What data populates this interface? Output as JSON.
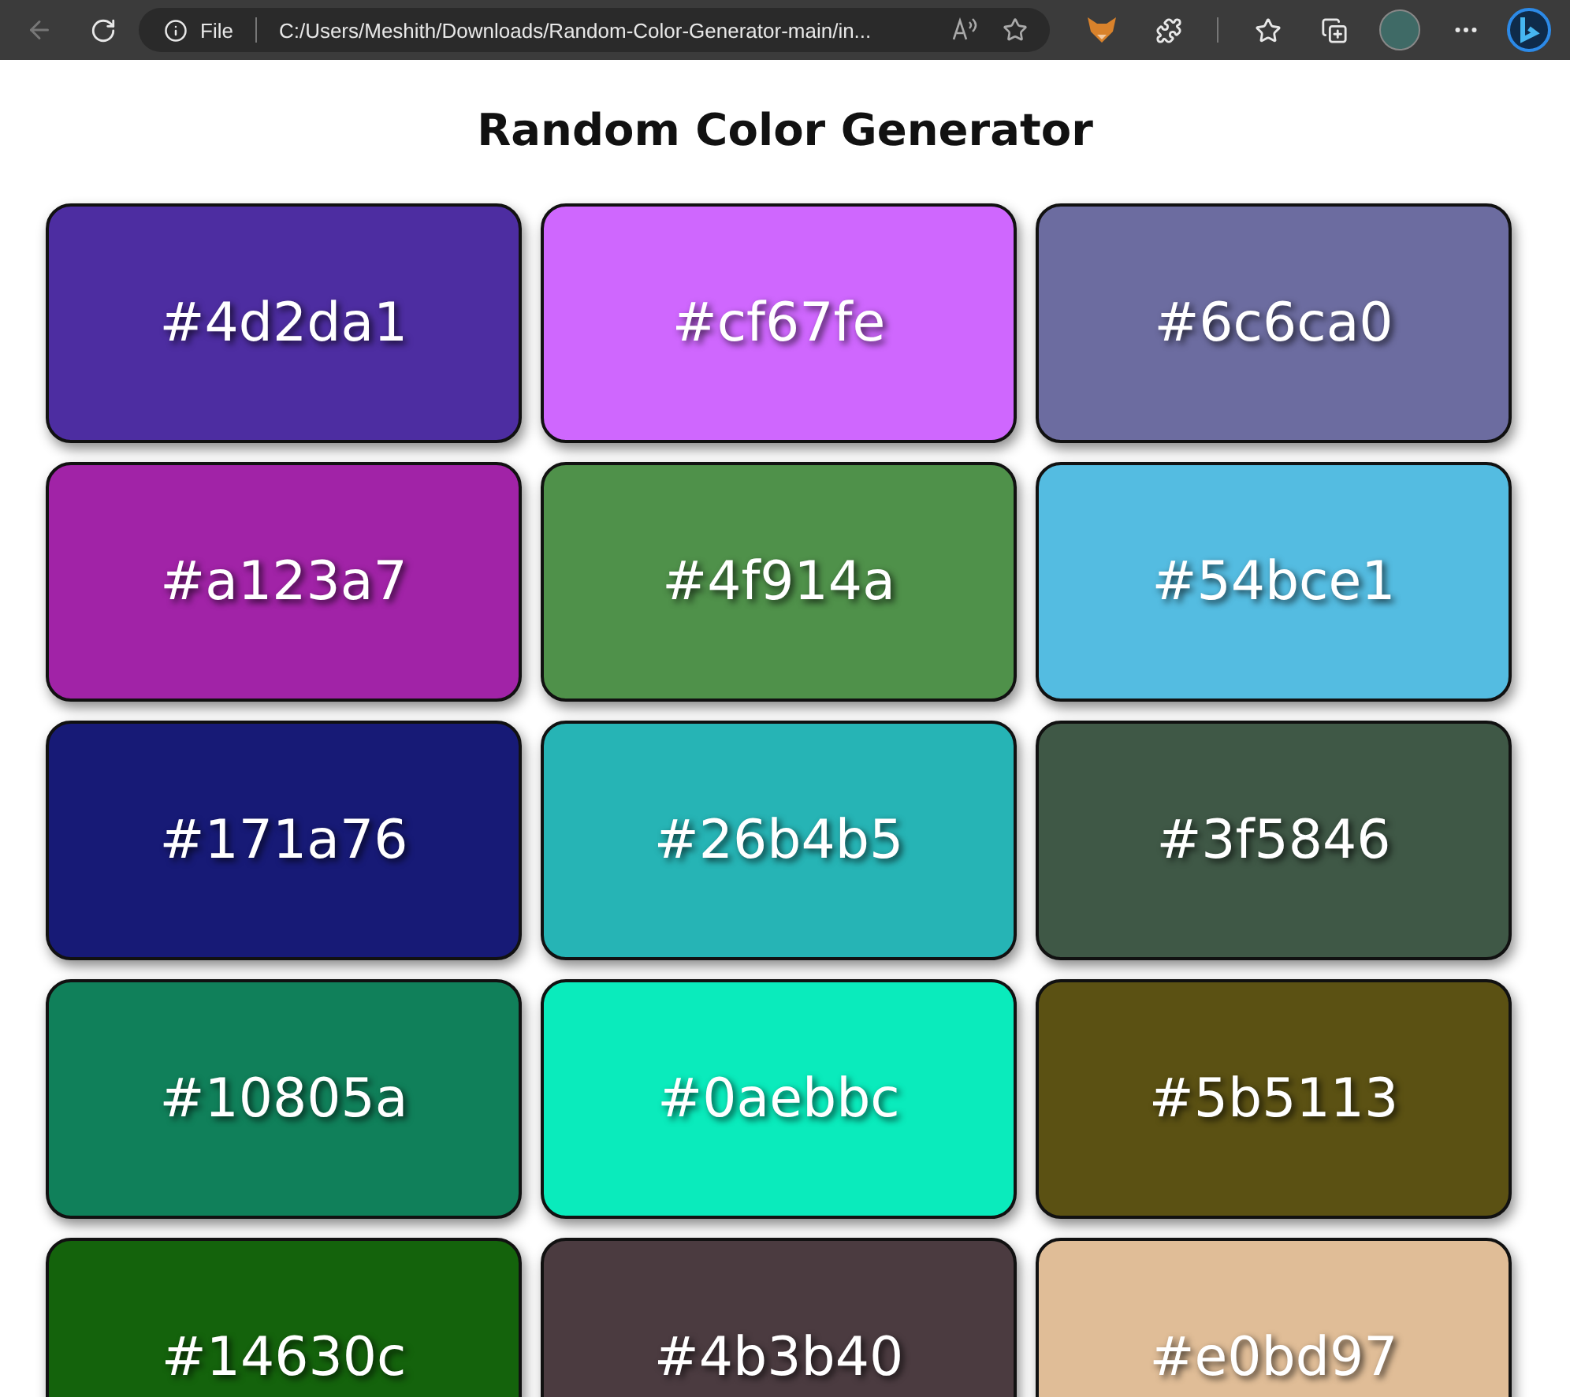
{
  "browser": {
    "back_disabled": true,
    "scheme": "File",
    "url": "C:/Users/Meshith/Downloads/Random-Color-Generator-main/in..."
  },
  "page": {
    "title": "Random Color Generator",
    "cards": [
      {
        "label": "#4d2da1",
        "color": "#4d2da1"
      },
      {
        "label": "#cf67fe",
        "color": "#cf67fe"
      },
      {
        "label": "#6c6ca0",
        "color": "#6c6ca0"
      },
      {
        "label": "#a123a7",
        "color": "#a123a7"
      },
      {
        "label": "#4f914a",
        "color": "#4f914a"
      },
      {
        "label": "#54bce1",
        "color": "#54bce1"
      },
      {
        "label": "#171a76",
        "color": "#171a76"
      },
      {
        "label": "#26b4b5",
        "color": "#26b4b5"
      },
      {
        "label": "#3f5846",
        "color": "#3f5846"
      },
      {
        "label": "#10805a",
        "color": "#10805a"
      },
      {
        "label": "#0aebbc",
        "color": "#0aebbc"
      },
      {
        "label": "#5b5113",
        "color": "#5b5113"
      },
      {
        "label": "#14630c",
        "color": "#14630c"
      },
      {
        "label": "#4b3b40",
        "color": "#4b3b40"
      },
      {
        "label": "#e0bd97",
        "color": "#e0bd97"
      }
    ]
  }
}
